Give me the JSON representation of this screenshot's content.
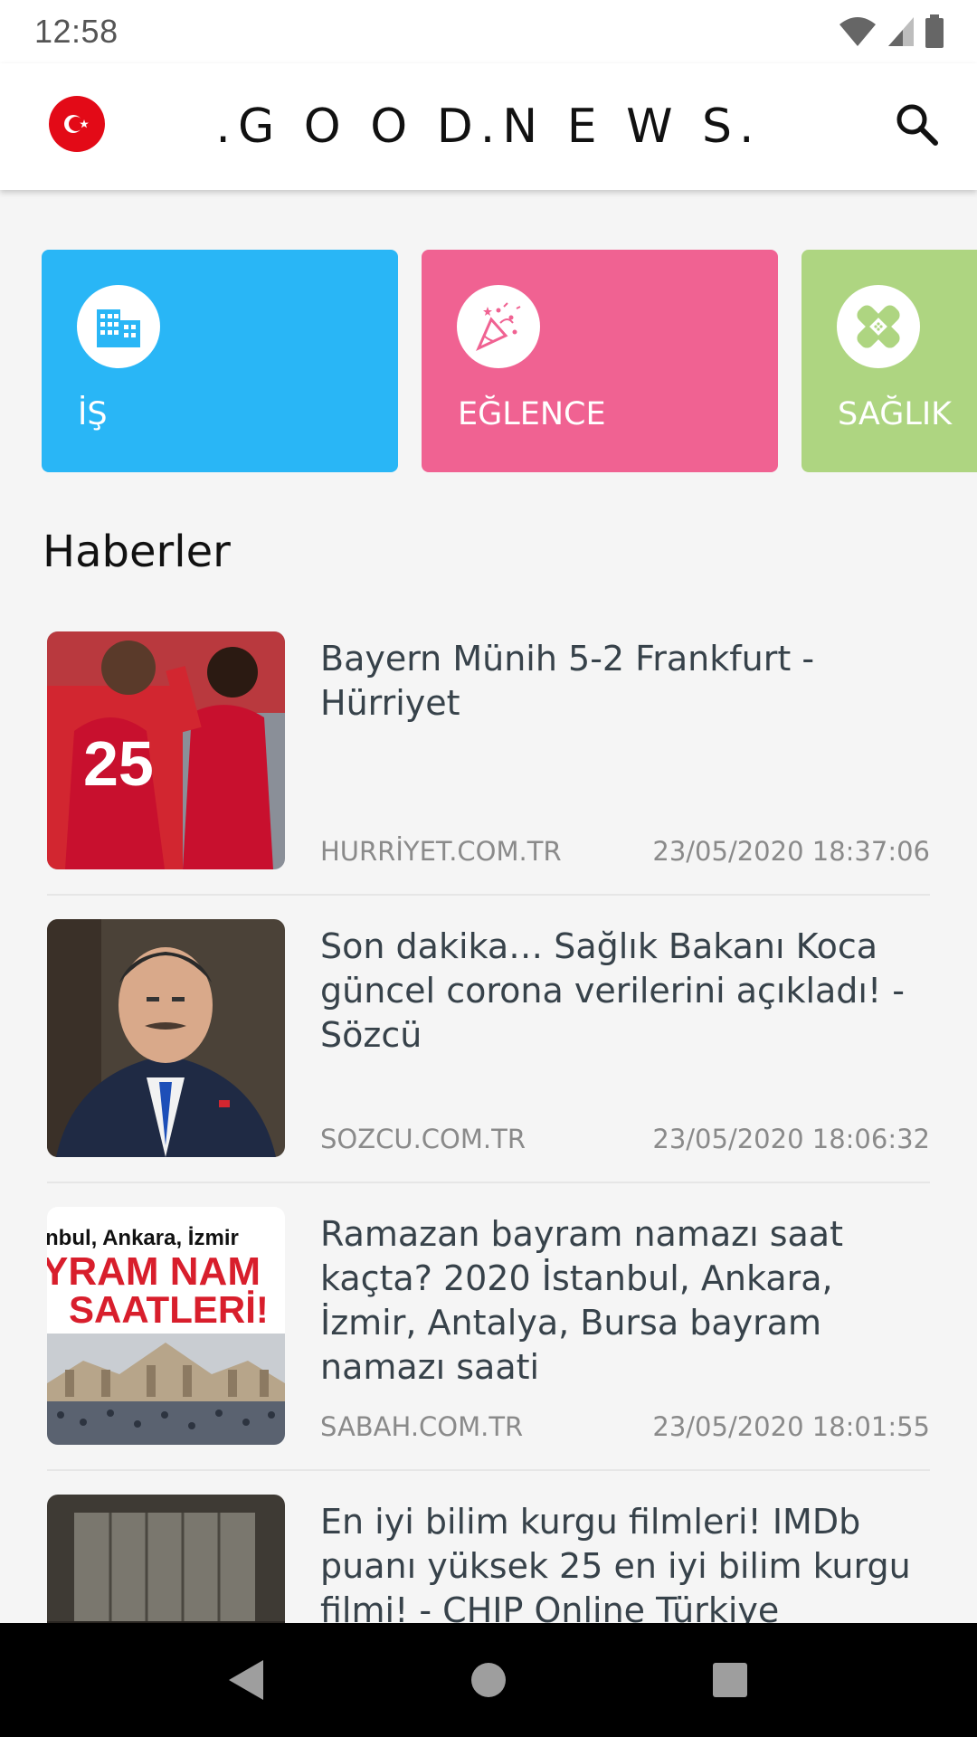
{
  "status_bar": {
    "time": "12:58",
    "icons": [
      "wifi-icon",
      "signal-icon",
      "battery-icon"
    ]
  },
  "app_bar": {
    "title": ".G O O D.N E W S.",
    "flag_icon": "turkey-flag-icon",
    "search_icon": "search-icon"
  },
  "categories": [
    {
      "label": "İŞ",
      "icon": "office-building-icon",
      "color": "#29b6f6"
    },
    {
      "label": "EĞLENCE",
      "icon": "party-confetti-icon",
      "color": "#f06292"
    },
    {
      "label": "SAĞLIK",
      "icon": "bandage-icon",
      "color": "#aed581"
    }
  ],
  "section": {
    "title": "Haberler"
  },
  "news": [
    {
      "title": "Bayern Münih 5-2 Frankfurt - Hürriyet",
      "source": "HURRİYET.COM.TR",
      "date": "23/05/2020 18:37:06"
    },
    {
      "title": "Son dakika… Sağlık Bakanı Koca güncel corona verilerini açıkladı! - Sözcü",
      "source": "SOZCU.COM.TR",
      "date": "23/05/2020 18:06:32"
    },
    {
      "title": "Ramazan bayram namazı saat kaçta? 2020 İstanbul, Ankara, İzmir, Antalya, Bursa bayram namazı saati",
      "source": "SABAH.COM.TR",
      "date": "23/05/2020 18:01:55",
      "thumb_text": [
        "nbul, Ankara, İzmir",
        "YRAM NAM",
        "SAATLERİ!"
      ]
    },
    {
      "title": "En iyi bilim kurgu filmleri! IMDb puanı yüksek 25 en iyi bilim kurgu filmi! - CHIP Online Türkiye"
    }
  ],
  "nav_bar": {
    "buttons": [
      "back-icon",
      "home-icon",
      "recents-icon"
    ]
  }
}
